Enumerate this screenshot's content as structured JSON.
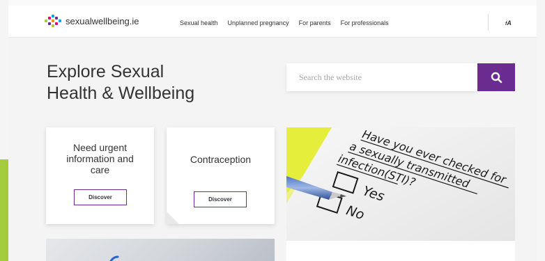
{
  "header": {
    "logo_text": "sexualwellbeing.ie",
    "nav": [
      "Sexual health",
      "Unplanned pregnancy",
      "For parents",
      "For professionals"
    ],
    "language_toggle": "A"
  },
  "hero": {
    "title_line1": "Explore Sexual",
    "title_line2": "Health & Wellbeing"
  },
  "search": {
    "placeholder": "Search the website"
  },
  "cards": [
    {
      "title_lines": [
        "Need urgent",
        "information and",
        "care"
      ],
      "button": "Discover"
    },
    {
      "title": "Contraception",
      "button": "Discover"
    }
  ],
  "photo": {
    "form_lines": [
      "Have you ever checked for",
      "a sexually transmitted",
      "infection(STI)?"
    ],
    "yes": "Yes",
    "no": "No"
  },
  "colors": {
    "brand_purple": "#6b2c91",
    "accent_green": "#a4cc3c",
    "form_yellow": "#e8f04a"
  },
  "icons": [
    "logo-dots-icon",
    "search-icon",
    "language-icon"
  ]
}
